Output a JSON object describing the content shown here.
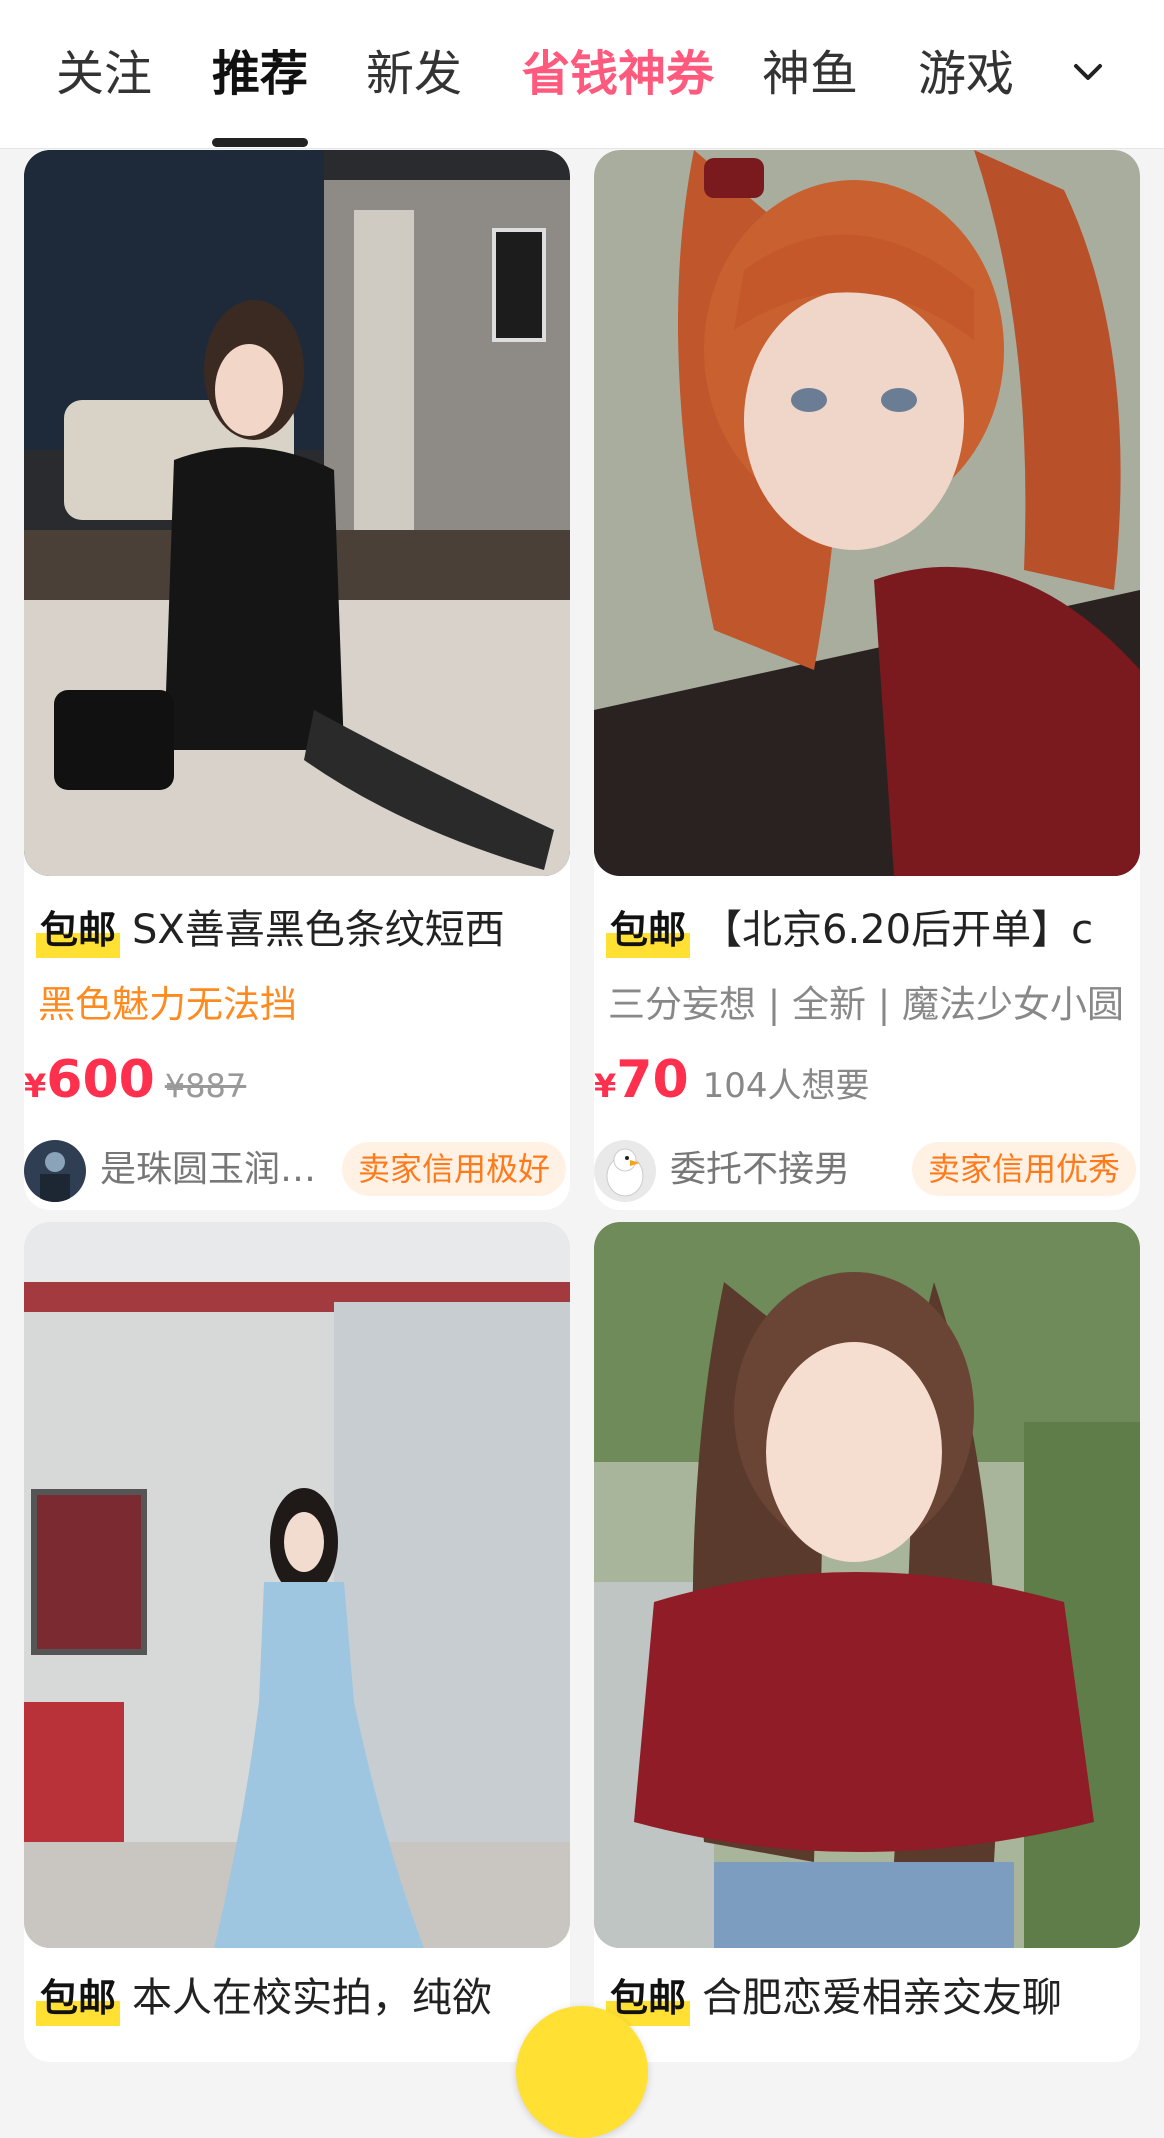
{
  "tabs": [
    {
      "label": "关注",
      "state": "normal"
    },
    {
      "label": "推荐",
      "state": "active"
    },
    {
      "label": "新发",
      "state": "normal"
    },
    {
      "label": "省钱神券",
      "state": "promo"
    },
    {
      "label": "神鱼",
      "state": "normal"
    },
    {
      "label": "游戏",
      "state": "normal"
    }
  ],
  "more_icon": "chevron-down-icon",
  "colors": {
    "accent": "#ffe033",
    "price": "#ff2f4e",
    "promo": "#ff5a7d",
    "credit": "#ff7a1a"
  },
  "products": [
    {
      "badge": "包邮",
      "title": "SX善喜黑色条纹短西",
      "subtitle": "黑色魅力无法挡",
      "currency": "¥",
      "price": "600",
      "original_price": "¥887",
      "seller": "是珠圆玉润…",
      "credit": "卖家信用极好"
    },
    {
      "badge": "包邮",
      "title": "【北京6.20后开单】c",
      "subtitle": "三分妄想 | 全新 | 魔法少女小圆",
      "currency": "¥",
      "price": "70",
      "want": "104人想要",
      "seller": "委托不接男",
      "credit": "卖家信用优秀"
    },
    {
      "badge": "包邮",
      "title": "本人在校实拍，纯欲"
    },
    {
      "badge": "包邮",
      "title": "合肥恋爱相亲交友聊"
    }
  ]
}
